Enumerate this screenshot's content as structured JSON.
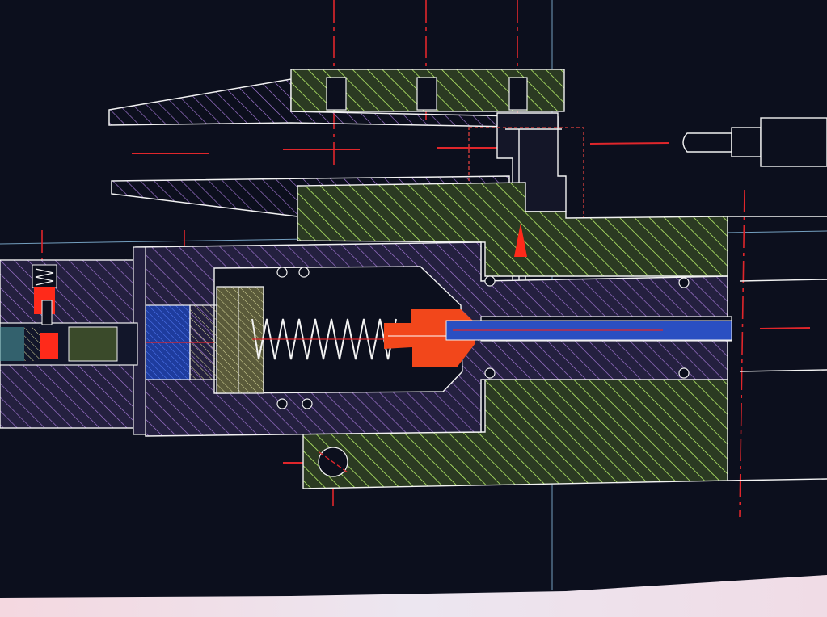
{
  "viewport": {
    "background": "#0c0f1d",
    "screen_glare": "#f0d4dc"
  },
  "layers": {
    "outline": "#f2f2f2",
    "centerline": "#e0262b",
    "crosshair": "#8ec4e8",
    "hatch_purple": "#a77ad8",
    "hatch_green": "#b8f06a",
    "fill_green_base": "#2b3a22",
    "fill_purple_base": "#24203f",
    "fill_blue": "#2a4fc2",
    "fill_blue_dark": "#1e3c9e",
    "fill_red": "#f2471b",
    "fill_red_bright": "#ff2a1a",
    "fill_khaki": "#5a5a3a",
    "fill_teal": "#4ea0a4",
    "dotted_boundary": "#c23a3a"
  },
  "components": [
    {
      "name": "upper-jaw",
      "layer": "hatch_purple"
    },
    {
      "name": "lower-jaw",
      "layer": "hatch_purple"
    },
    {
      "name": "upper-jaw-block",
      "layer": "hatch_green"
    },
    {
      "name": "lower-jaw-block",
      "layer": "hatch_green"
    },
    {
      "name": "cylinder-housing",
      "layer": "hatch_purple"
    },
    {
      "name": "compression-spring",
      "layer": "outline"
    },
    {
      "name": "piston",
      "layer": "fill_red"
    },
    {
      "name": "piston-rod",
      "layer": "fill_blue"
    },
    {
      "name": "end-cap",
      "layer": "fill_khaki"
    },
    {
      "name": "coupling-disc",
      "layer": "fill_blue"
    },
    {
      "name": "left-adapter",
      "layer": "hatch_purple"
    },
    {
      "name": "lower-base-block",
      "layer": "hatch_green"
    },
    {
      "name": "right-end-block",
      "layer": "hatch_green"
    },
    {
      "name": "probe-pin",
      "layer": "outline"
    },
    {
      "name": "detail-boundary",
      "layer": "dotted_boundary"
    }
  ]
}
